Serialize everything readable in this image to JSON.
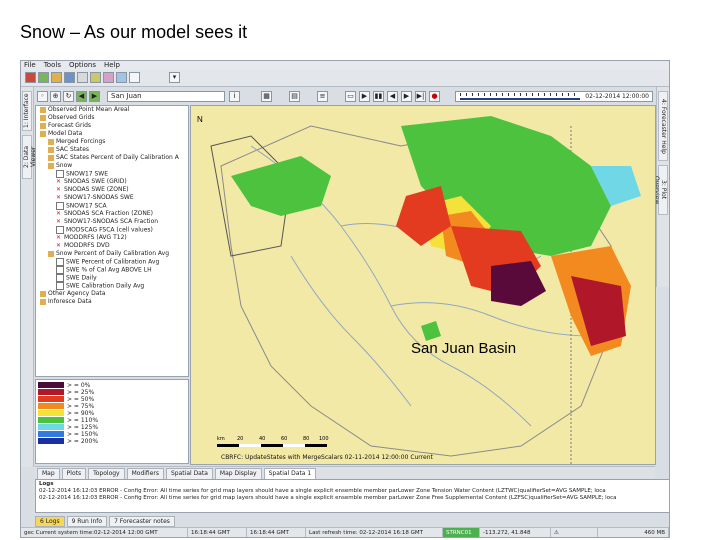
{
  "slide_title": "Snow – As our model sees it",
  "menu": [
    "File",
    "Tools",
    "Options",
    "Help"
  ],
  "left_tabs": [
    "1: Interface",
    "2: Data Viewer"
  ],
  "right_tabs": [
    "4: Forecaster Help",
    "3: Plot Overview"
  ],
  "location_combo": "San Juan",
  "time_display": "02-12-2014 12:00:00",
  "tree_items": [
    {
      "label": "Observed Point Mean Areal",
      "indent": 0,
      "icon": "folder"
    },
    {
      "label": "Observed Grids",
      "indent": 0,
      "icon": "folder"
    },
    {
      "label": "Forecast Grids",
      "indent": 0,
      "icon": "folder"
    },
    {
      "label": "Model Data",
      "indent": 0,
      "icon": "folder"
    },
    {
      "label": "Merged Forcings",
      "indent": 1,
      "icon": "folder"
    },
    {
      "label": "SAC States",
      "indent": 1,
      "icon": "folder"
    },
    {
      "label": "SAC States Percent of Daily Calibration A",
      "indent": 1,
      "icon": "folder"
    },
    {
      "label": "Snow",
      "indent": 1,
      "icon": "folder"
    },
    {
      "label": "SNOW17 SWE",
      "indent": 2,
      "icon": "doc"
    },
    {
      "label": "SNODAS SWE (GRID)",
      "indent": 2,
      "icon": "x"
    },
    {
      "label": "SNODAS SWE (ZONE)",
      "indent": 2,
      "icon": "x"
    },
    {
      "label": "SNOW17-SNODAS SWE",
      "indent": 2,
      "icon": "x"
    },
    {
      "label": "SNOW17 SCA",
      "indent": 2,
      "icon": "doc"
    },
    {
      "label": "SNODAS SCA Fraction (ZONE)",
      "indent": 2,
      "icon": "x"
    },
    {
      "label": "SNOW17-SNODAS SCA Fraction",
      "indent": 2,
      "icon": "x"
    },
    {
      "label": "MODSCAG FSCA (cell values)",
      "indent": 2,
      "icon": "doc"
    },
    {
      "label": "MODDRFS (AVG T12)",
      "indent": 2,
      "icon": "x"
    },
    {
      "label": "MODDRFS DVD",
      "indent": 2,
      "icon": "x"
    },
    {
      "label": "Snow Percent of Daily Calibration Avg",
      "indent": 1,
      "icon": "folder"
    },
    {
      "label": "SWE Percent of Calibration Avg",
      "indent": 2,
      "icon": "doc"
    },
    {
      "label": "SWE % of Cal Avg ABOVE LH",
      "indent": 2,
      "icon": "doc"
    },
    {
      "label": "SWE Daily",
      "indent": 2,
      "icon": "doc"
    },
    {
      "label": "SWE Calibration Daily Avg",
      "indent": 2,
      "icon": "doc"
    },
    {
      "label": "Other Agency Data",
      "indent": 0,
      "icon": "folder"
    },
    {
      "label": "Inforesce Data",
      "indent": 0,
      "icon": "folder"
    }
  ],
  "legend": [
    {
      "label": "> = 0%",
      "color": "#4a0a3a"
    },
    {
      "label": "> = 25%",
      "color": "#b0182a"
    },
    {
      "label": "> = 50%",
      "color": "#e23b1f"
    },
    {
      "label": "> = 75%",
      "color": "#f28a20"
    },
    {
      "label": "> = 90%",
      "color": "#f4e23a"
    },
    {
      "label": "> = 110%",
      "color": "#4cc23e"
    },
    {
      "label": "> = 125%",
      "color": "#6fd7e6"
    },
    {
      "label": "> = 150%",
      "color": "#2f7be0"
    },
    {
      "label": "> = 200%",
      "color": "#1b2f9e"
    }
  ],
  "map_label": "San Juan Basin",
  "map_status": "CBRFC: UpdateStates with MergeScalars  02-11-2014 12:00:00 Current",
  "scale_labels": [
    "km",
    "20",
    "40",
    "60",
    "80",
    "100"
  ],
  "north_label": "N",
  "view_tabs": [
    {
      "label": "Map",
      "active": false
    },
    {
      "label": "Plots",
      "active": false
    },
    {
      "label": "Topology",
      "active": false
    },
    {
      "label": "Modifiers",
      "active": false
    },
    {
      "label": "Spatial Data",
      "active": false
    },
    {
      "label": "Map Display",
      "active": false
    },
    {
      "label": "Spatial Data 1",
      "active": true
    }
  ],
  "logs_header": "Logs",
  "log_lines": [
    "02-12-2014 16:12:03 ERROR - Config Error: All time series for grid map layers should have a single explicit ensemble member parLower Zone Tension Water Content (LZTWC)qualifierSet=AVG SAMPLE; loca",
    "02-12-2014 16:12:03 ERROR - Config Error: All time series for grid map layers should have a single explicit ensemble member parLower Zone Free Supplemental Content (LZFSC)qualifierSet=AVG SAMPLE; loca"
  ],
  "bottom_tabs": [
    {
      "label": "6 Logs",
      "active": true
    },
    {
      "label": "9 Run Info",
      "active": false
    },
    {
      "label": "7 Forecaster notes",
      "active": false
    }
  ],
  "status": {
    "sys_time": "gec Current system time:02-12-2014 12:00 GMT",
    "t1": "16:18:44 GMT",
    "t2": "16:18:44 GMT",
    "refresh": "Last refresh time: 02-12-2014 16:18 GMT",
    "station": "STRNC01",
    "coords": "-113.272, 41.848",
    "memory": "460 MB"
  }
}
